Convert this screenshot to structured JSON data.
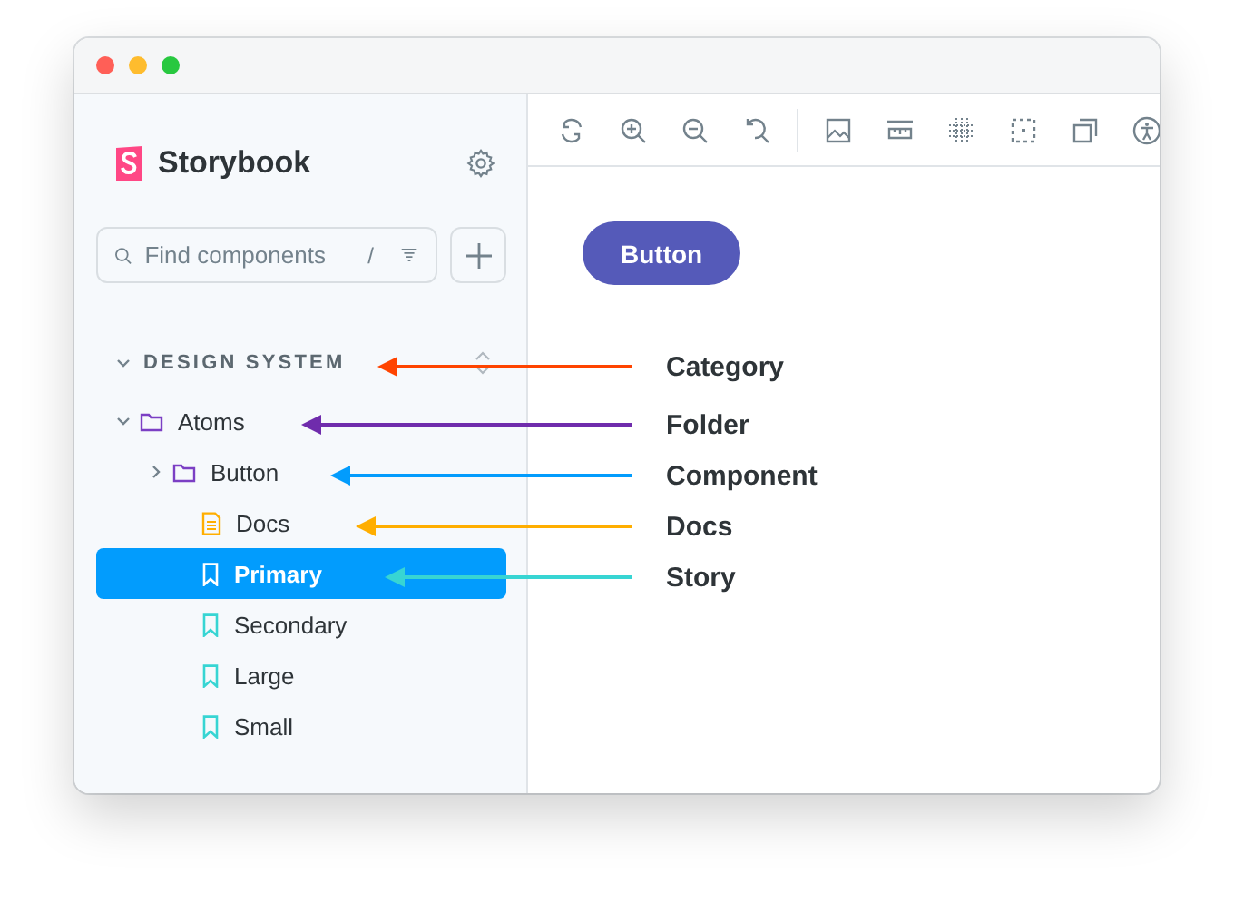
{
  "sidebar": {
    "logo": "Storybook",
    "search": {
      "placeholder": "Find components",
      "shortcut": "/"
    },
    "tree": [
      {
        "kind": "category",
        "label": "DESIGN SYSTEM",
        "expanded": true,
        "children": [
          {
            "kind": "folder",
            "label": "Atoms",
            "expanded": true,
            "children": [
              {
                "kind": "component",
                "label": "Button",
                "expanded": false,
                "children": [
                  {
                    "kind": "docs",
                    "label": "Docs",
                    "selected": false
                  },
                  {
                    "kind": "story",
                    "label": "Primary",
                    "selected": true
                  },
                  {
                    "kind": "story",
                    "label": "Secondary",
                    "selected": false
                  },
                  {
                    "kind": "story",
                    "label": "Large",
                    "selected": false
                  },
                  {
                    "kind": "story",
                    "label": "Small",
                    "selected": false
                  }
                ]
              }
            ]
          }
        ]
      }
    ]
  },
  "preview": {
    "button": "Button"
  },
  "annotations": [
    {
      "label": "Category",
      "color": "#ff4400"
    },
    {
      "label": "Folder",
      "color": "#6f2cac"
    },
    {
      "label": "Component",
      "color": "#029cfd"
    },
    {
      "label": "Docs",
      "color": "#ffae00"
    },
    {
      "label": "Story",
      "color": "#37d5d3"
    }
  ]
}
